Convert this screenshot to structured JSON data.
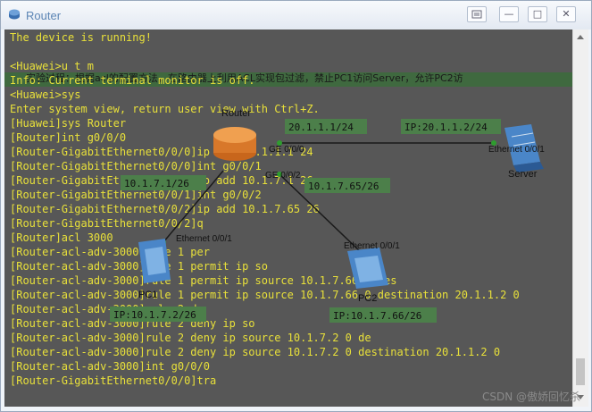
{
  "window": {
    "title": "Router",
    "controls": {
      "restore_label": "□",
      "minimize_label": "—",
      "maximize_label": "□",
      "close_label": "✕"
    }
  },
  "terminal": {
    "lines": [
      "The device is running!",
      "",
      "<Huawei>u t m",
      "Info: Current terminal monitor is off.",
      "<Huawei>sys",
      "Enter system view, return user view with Ctrl+Z.",
      "[Huawei]sys Router",
      "[Router]int g0/0/0",
      "[Router-GigabitEthernet0/0/0]ip add 20.1.1.1 24",
      "[Router-GigabitEthernet0/0/0]int g0/0/1",
      "[Router-GigabitEthernet0/0/1]ip add 10.1.7.1 26",
      "[Router-GigabitEthernet0/0/1]int g0/0/2",
      "[Router-GigabitEthernet0/0/2]ip add 10.1.7.65 26",
      "[Router-GigabitEthernet0/0/2]q",
      "[Router]acl 3000",
      "[Router-acl-adv-3000]rule 1 per",
      "[Router-acl-adv-3000]rule 1 permit ip so",
      "[Router-acl-adv-3000]rule 1 permit ip source 10.1.7.66 0 des",
      "[Router-acl-adv-3000]rule 1 permit ip source 10.1.7.66 0 destination 20.1.1.2 0",
      "[Router-acl-adv-3000]rule 2 de",
      "[Router-acl-adv-3000]rule 2 deny ip so",
      "[Router-acl-adv-3000]rule 2 deny ip source 10.1.7.2 0 de",
      "[Router-acl-adv-3000]rule 2 deny ip source 10.1.7.2 0 destination 20.1.1.2 0",
      "[Router-acl-adv-3000]int g0/0/0",
      "[Router-GigabitEthernet0/0/0]tra"
    ],
    "overlay_text": "实验过程：根据acl的配置方法，在路由器上利用ACL实现包过滤，禁止PC1访问Server，允许PC2访"
  },
  "topology": {
    "router_label": "Router",
    "server_label": "Server",
    "pc1_label": "PC1",
    "pc2_label": "PC2",
    "port_router_g000": "GE 0/0/0",
    "port_router_g002": "GE 0/0/2",
    "port_server": "Ethernet 0/0/1",
    "port_pc1": "Ethernet 0/0/1",
    "port_pc2": "Ethernet 0/0/1",
    "tag_router_g000": "20.1.1.1/24",
    "tag_server_ip": "IP:20.1.1.2/24",
    "tag_router_g002": "10.1.7.65/26",
    "tag_router_g001": "10.1.7.1/26",
    "tag_pc1_ip": "IP:10.1.7.2/26",
    "tag_pc2_ip": "IP:10.1.7.66/26"
  },
  "watermark": "CSDN @傲娇回忆杀"
}
